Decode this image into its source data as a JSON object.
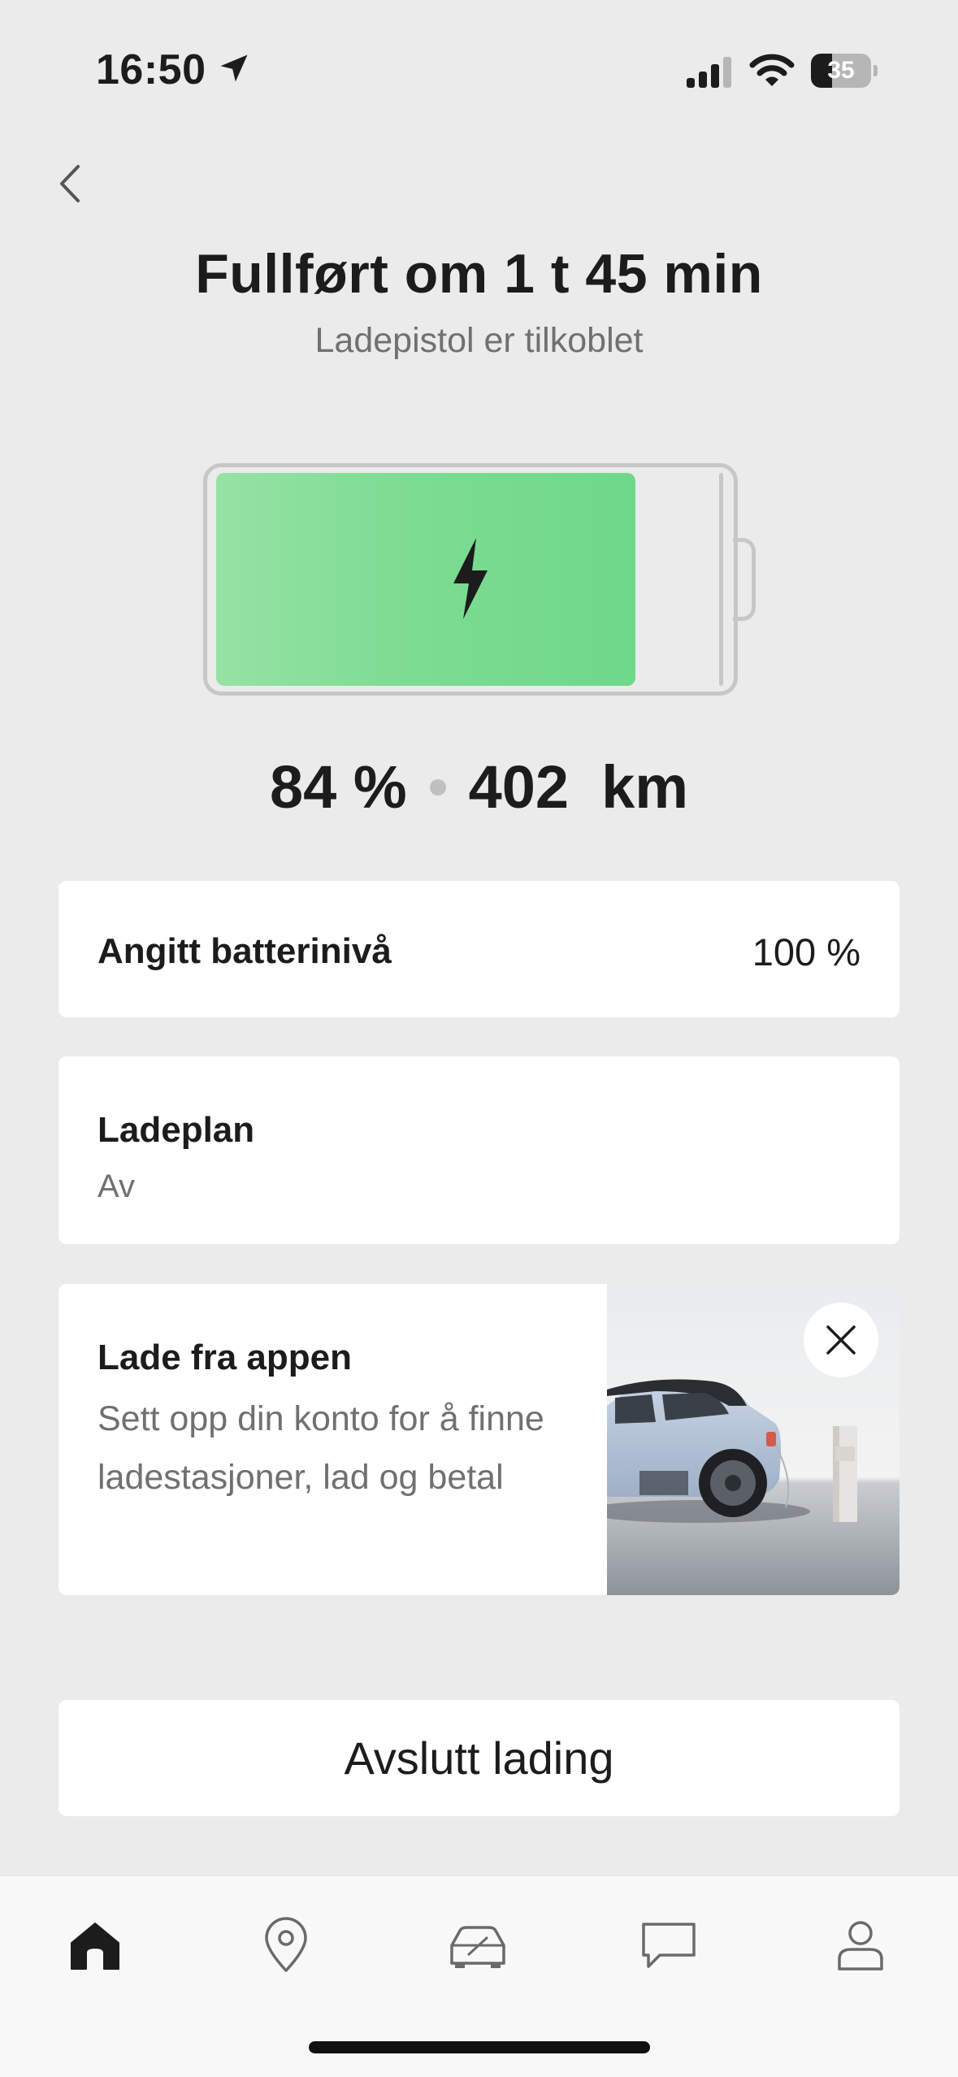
{
  "status_bar": {
    "time": "16:50",
    "battery_level": "35",
    "icons": [
      "location-arrow-icon",
      "cellular-signal-icon",
      "wifi-icon",
      "battery-icon"
    ]
  },
  "header": {
    "title": "Fullført om 1 t 45 min",
    "subtitle": "Ladepistol er tilkoblet"
  },
  "battery": {
    "charge_fraction": 0.84,
    "percent_label": "84 %",
    "range_value": "402",
    "range_unit": "km",
    "fill_color": "#6fd88a"
  },
  "target_card": {
    "label": "Angitt batterinivå",
    "value": "100 %"
  },
  "plan_card": {
    "label": "Ladeplan",
    "value": "Av"
  },
  "promo_card": {
    "title": "Lade fra appen",
    "description": "Sett opp din konto for å finne ladestasjoner, lad og betal",
    "image": "car-charging-image"
  },
  "actions": {
    "stop_label": "Avslutt lading"
  },
  "tab_bar": {
    "items": [
      {
        "icon": "home-icon",
        "active": true
      },
      {
        "icon": "map-pin-icon",
        "active": false
      },
      {
        "icon": "car-icon",
        "active": false
      },
      {
        "icon": "chat-icon",
        "active": false
      },
      {
        "icon": "profile-icon",
        "active": false
      }
    ]
  }
}
